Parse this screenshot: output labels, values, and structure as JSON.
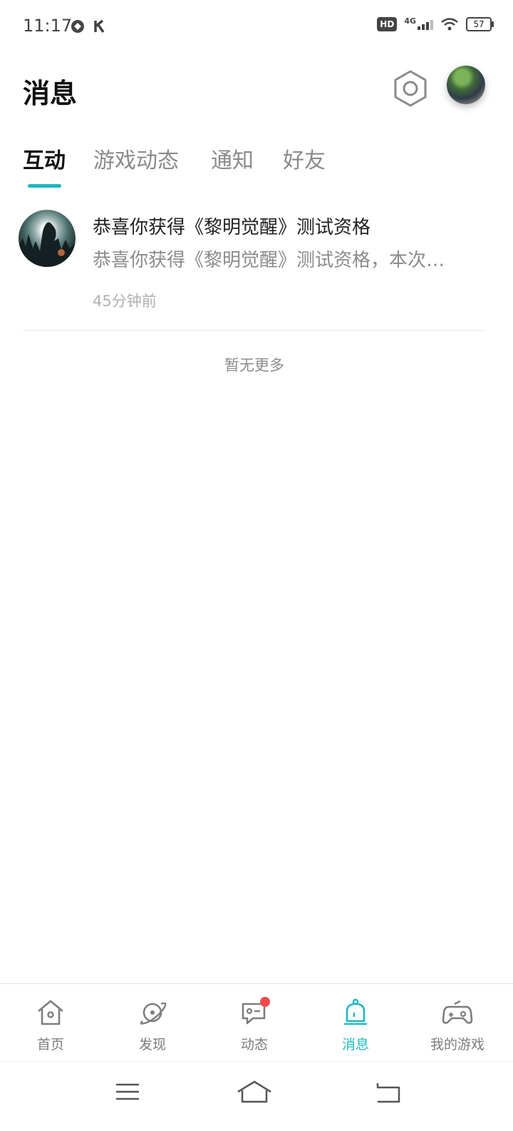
{
  "status_bar": {
    "time": "11:17",
    "left_icons": [
      "sync-icon",
      "k-app-icon"
    ],
    "hd": "HD",
    "network": "4G",
    "battery": "57"
  },
  "header": {
    "title": "消息",
    "settings_icon": "hexagon-settings-icon"
  },
  "tabs": [
    {
      "label": "互动",
      "active": true
    },
    {
      "label": "游戏动态",
      "active": false
    },
    {
      "label": "通知",
      "active": false
    },
    {
      "label": "好友",
      "active": false
    }
  ],
  "messages": [
    {
      "title": "恭喜你获得《黎明觉醒》测试资格",
      "preview": "恭喜你获得《黎明觉醒》测试资格，本次…",
      "time": "45分钟前"
    }
  ],
  "footer_text": "暂无更多",
  "bottom_nav": [
    {
      "label": "首页",
      "icon": "home-icon",
      "active": false
    },
    {
      "label": "发现",
      "icon": "planet-icon",
      "active": false
    },
    {
      "label": "动态",
      "icon": "chat-icon",
      "active": false,
      "badge": true
    },
    {
      "label": "消息",
      "icon": "bell-icon",
      "active": true
    },
    {
      "label": "我的游戏",
      "icon": "gamepad-icon",
      "active": false
    }
  ],
  "colors": {
    "accent": "#1fb7c1",
    "badge": "#f24b4b",
    "text_primary": "#222222",
    "text_secondary": "#8b8b8b"
  }
}
